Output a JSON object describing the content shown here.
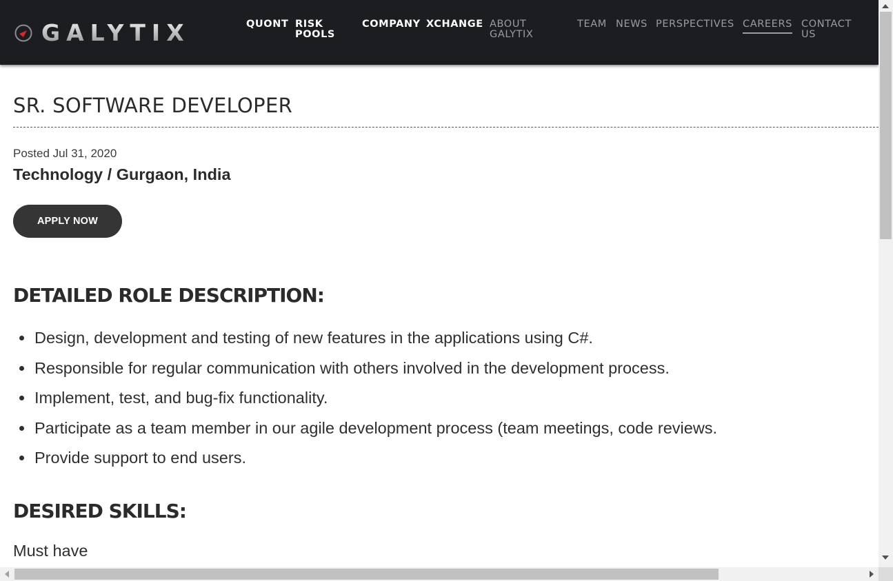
{
  "header": {
    "logo_text": "GALYTIX",
    "nav": [
      {
        "label": "QUONT",
        "style": "bold"
      },
      {
        "label": "RISK\nPOOLS",
        "style": "bold"
      },
      {
        "label": "COMPANY",
        "style": "bold"
      },
      {
        "label": "XCHANGE",
        "style": "bold"
      },
      {
        "label": "ABOUT\nGALYTIX",
        "style": "light"
      },
      {
        "label": "TEAM",
        "style": "light"
      },
      {
        "label": "NEWS",
        "style": "light"
      },
      {
        "label": "PERSPECTIVES",
        "style": "light"
      },
      {
        "label": "CAREERS",
        "style": "light",
        "active": true
      },
      {
        "label": "CONTACT\nUS",
        "style": "light"
      }
    ]
  },
  "job": {
    "title": "SR. SOFTWARE DEVELOPER",
    "posted": "Posted Jul 31, 2020",
    "department_location": "Technology / Gurgaon, India",
    "apply_label": "APPLY NOW"
  },
  "role_section": {
    "heading": "DETAILED ROLE DESCRIPTION:",
    "items": [
      "Design, development and testing of new features in the applications using C#.",
      "Responsible for regular communication with others involved in the development process.",
      "Implement, test, and bug-fix functionality.",
      "Participate as a team member in our agile development process (team meetings, code reviews.",
      "Provide support to end users."
    ]
  },
  "skills_section": {
    "heading": "DESIRED SKILLS:",
    "subheading": "Must have"
  },
  "colors": {
    "header_bg": "#1b1d20",
    "button_bg": "#353535",
    "logo_accent": "#d42a2a"
  }
}
